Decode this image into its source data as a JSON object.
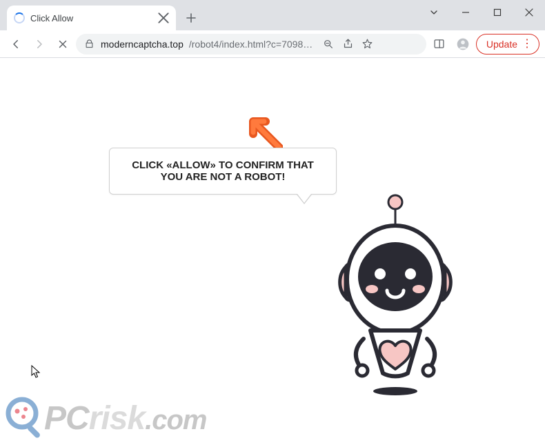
{
  "window": {
    "tab_title": "Click Allow"
  },
  "toolbar": {
    "url_host": "moderncaptcha.top",
    "url_path": "/robot4/index.html?c=7098…",
    "update_label": "Update"
  },
  "page": {
    "speech_text": "CLICK «ALLOW» TO CONFIRM THAT YOU ARE NOT A ROBOT!"
  },
  "watermark": {
    "pc": "PC",
    "risk": "risk",
    "com": ".com"
  },
  "colors": {
    "accent_red": "#d93025",
    "robot_pink": "#f7c6c4",
    "robot_dark": "#2a2a33"
  }
}
